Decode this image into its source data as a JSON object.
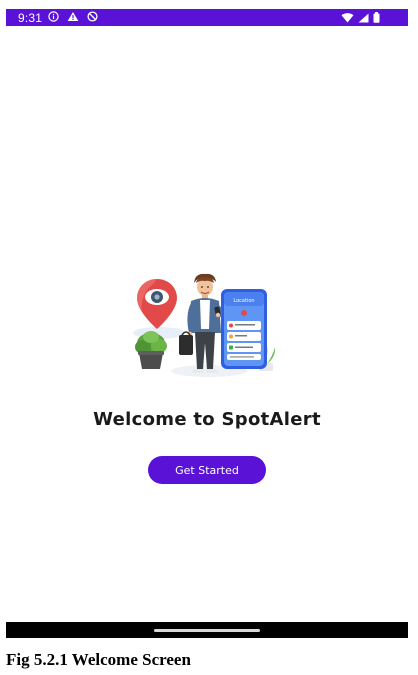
{
  "status_bar": {
    "time": "9:31",
    "left_icons": [
      "info-icon",
      "warning-icon",
      "do-not-disturb-icon"
    ],
    "right_icons": [
      "wifi-icon",
      "cellular-signal-icon",
      "battery-icon"
    ],
    "background": "#5a12d6"
  },
  "illustration": {
    "description_icons": [
      "location-pin-icon",
      "person-icon",
      "phone-icon",
      "plant-icon"
    ],
    "phone_header": "Location"
  },
  "welcome": {
    "title": "Welcome to SpotAlert"
  },
  "actions": {
    "get_started_label": "Get Started",
    "accent": "#5a12d6"
  },
  "caption": {
    "text": "Fig 5.2.1 Welcome Screen"
  }
}
